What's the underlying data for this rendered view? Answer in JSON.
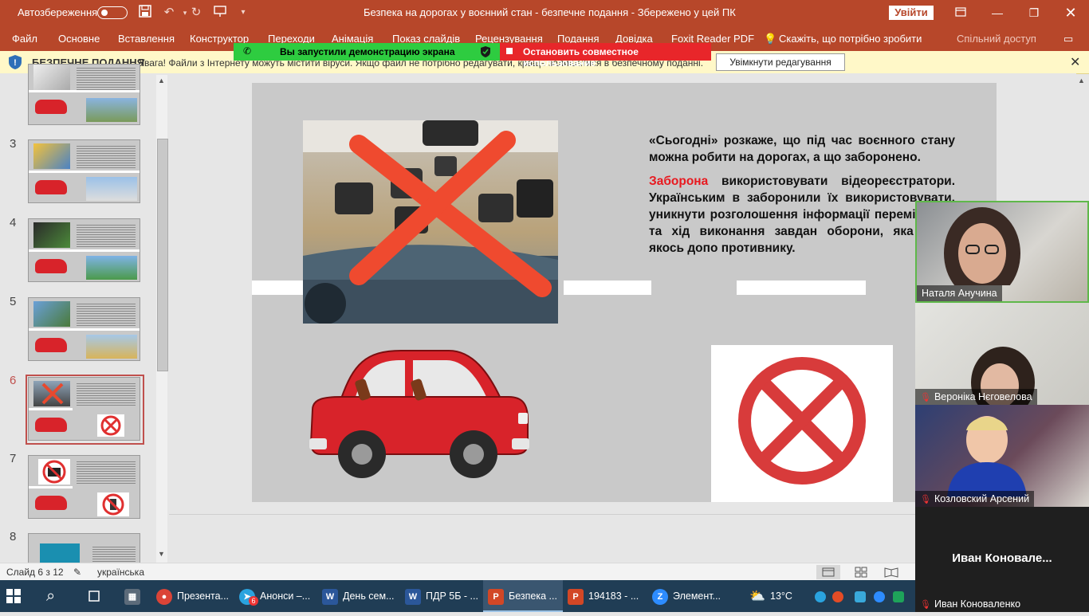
{
  "titlebar": {
    "autosave_label": "Автозбереження",
    "doc_title": "Безпека на дорогах у воєнний стан  -  безпечне подання  -  Збережено у цей ПК",
    "signin_label": "Увійти",
    "icons": [
      "save-icon",
      "undo-icon",
      "redo-icon",
      "presenter-icon",
      "customize-icon"
    ]
  },
  "ribbon": {
    "tabs": [
      "Файл",
      "Основне",
      "Вставлення",
      "Конструктор",
      "Переходи",
      "Анімація",
      "Показ слайдів",
      "Рецензування",
      "Подання",
      "Довідка",
      "Foxit Reader PDF"
    ],
    "tell_me": "Скажіть, що потрібно зробити",
    "share": "Спільний доступ"
  },
  "protected_view": {
    "title": "БЕЗПЕЧНЕ ПОДАННЯ",
    "message": "Увага! Файли з Інтернету можуть містити віруси. Якщо файл не потрібно редагувати, краще залишатися в безпечному поданні.",
    "enable_button": "Увімкнути редагування"
  },
  "screen_share": {
    "status": "Вы запустили демонстрацию экрана",
    "stop": "Остановить совместное использование"
  },
  "thumbnails": {
    "numbers": [
      "3",
      "4",
      "5",
      "6",
      "7",
      "8"
    ],
    "selected": "6"
  },
  "slide": {
    "intro": "«Сьогодні» розкаже, що під час воєнного стану можна робити на дорогах, а що заборонено.",
    "ban_word": "Заборона",
    "ban_text": " використовувати відеореєстратори. Українським в заборонили їх використовувати, уникнути розголошення інформації переміщення та хід виконання завдан оборони, яка може якось допо противнику."
  },
  "statusbar": {
    "slide_count": "Слайд 6 з 12",
    "language": "українська"
  },
  "participants": [
    {
      "name": "Наталя Анучина",
      "muted": false
    },
    {
      "name": "Вероніка Нєговелова",
      "muted": true
    },
    {
      "name": "Козловский Арсений",
      "muted": true
    },
    {
      "name": "Иван  Коновале...",
      "display": "Иван Коноваленко",
      "muted": true
    }
  ],
  "taskbar": {
    "items": [
      {
        "label": "Презента...",
        "icon": "chrome-icon",
        "color": "#db4437"
      },
      {
        "label": "Анонси –...",
        "icon": "telegram-icon",
        "color": "#2aa3df",
        "badge": "6"
      },
      {
        "label": "День сем...",
        "icon": "word-icon",
        "color": "#2b579a"
      },
      {
        "label": "ПДР 5Б - ...",
        "icon": "word-icon",
        "color": "#2b579a"
      },
      {
        "label": "Безпека ...",
        "icon": "powerpoint-icon",
        "color": "#d24726"
      },
      {
        "label": "194183  - ...",
        "icon": "powerpoint-icon",
        "color": "#d24726"
      },
      {
        "label": "Элемент...",
        "icon": "zoom-icon",
        "color": "#2d8cff"
      }
    ],
    "weather": "13°C"
  }
}
